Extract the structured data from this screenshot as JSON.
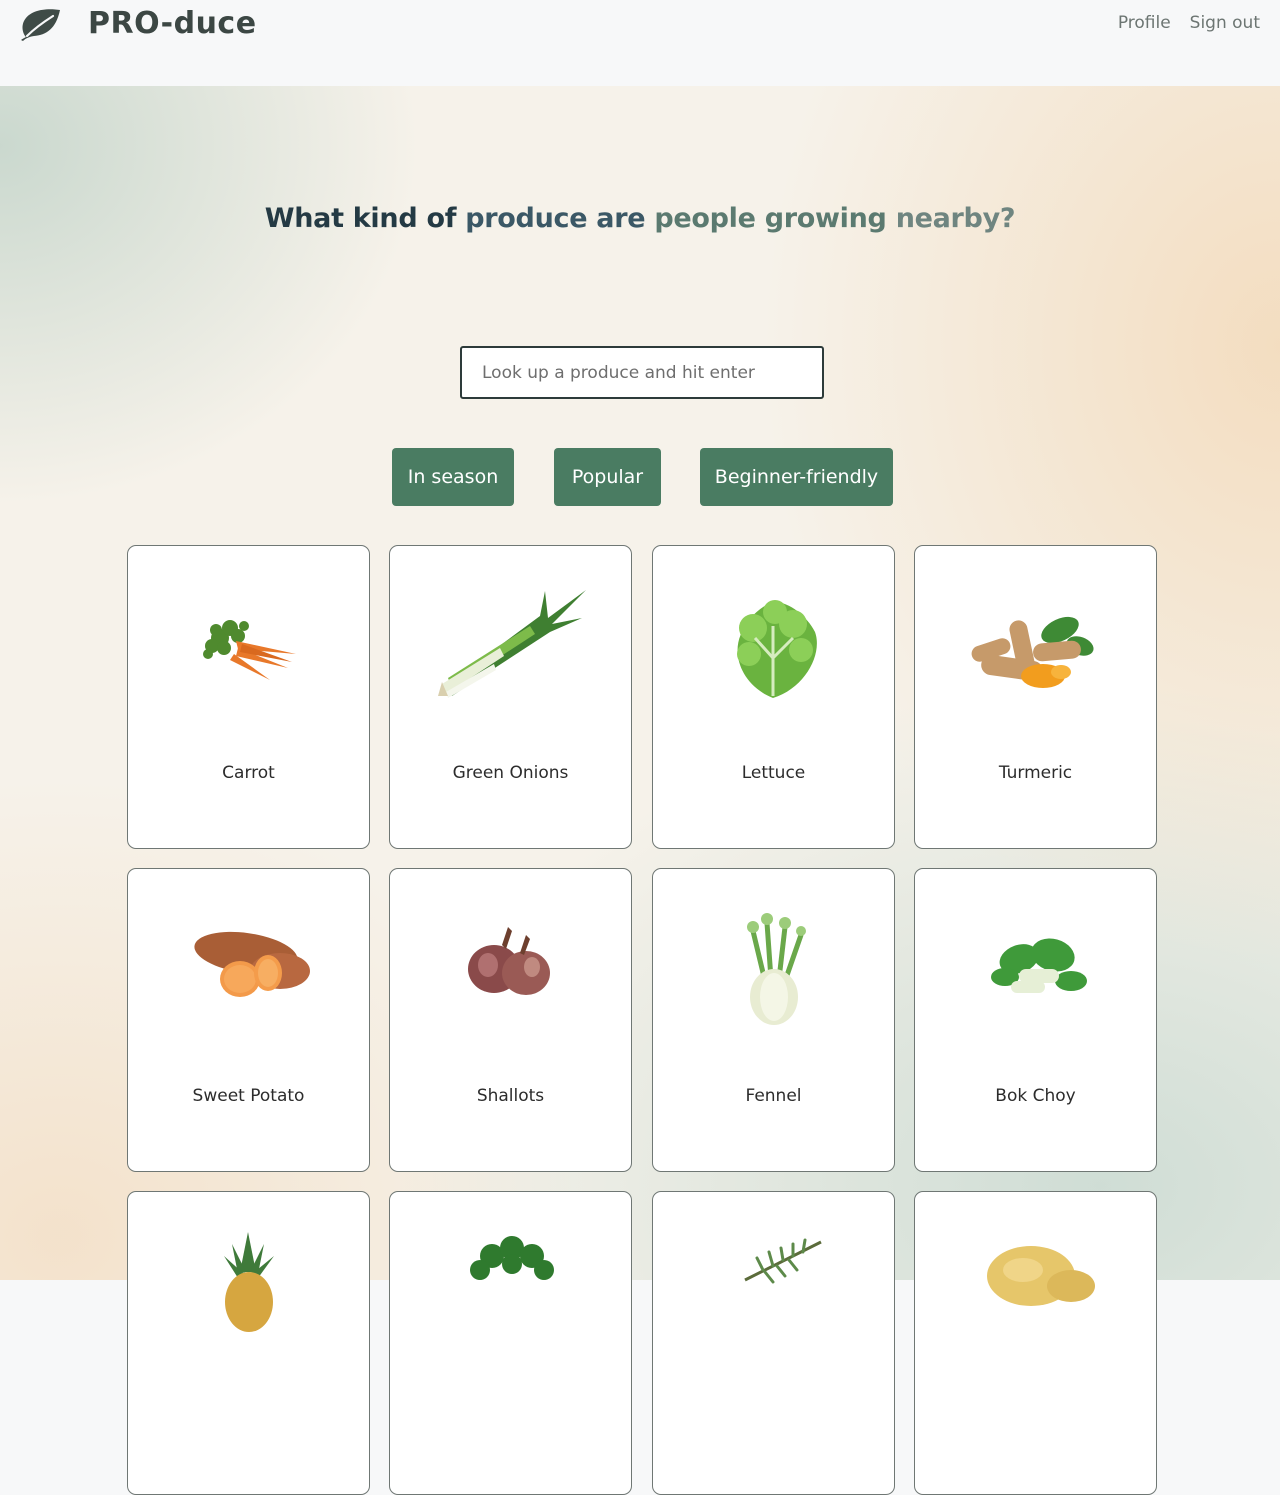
{
  "app": {
    "name": "PRO-duce",
    "logo_icon": "leaf-icon"
  },
  "nav": {
    "profile": "Profile",
    "sign_out": "Sign out"
  },
  "hero": {
    "headline_parts": [
      "What kind of ",
      "produce are ",
      "people growing ",
      "nearby?"
    ]
  },
  "search": {
    "placeholder": "Look up a produce and hit enter",
    "value": ""
  },
  "filters": [
    "In season",
    "Popular",
    "Beginner-friendly"
  ],
  "produce": [
    {
      "name": "Carrot",
      "icon": "carrot-icon"
    },
    {
      "name": "Green Onions",
      "icon": "green-onions-icon"
    },
    {
      "name": "Lettuce",
      "icon": "lettuce-icon"
    },
    {
      "name": "Turmeric",
      "icon": "turmeric-icon"
    },
    {
      "name": "Sweet Potato",
      "icon": "sweet-potato-icon"
    },
    {
      "name": "Shallots",
      "icon": "shallots-icon"
    },
    {
      "name": "Fennel",
      "icon": "fennel-icon"
    },
    {
      "name": "Bok Choy",
      "icon": "bok-choy-icon"
    },
    {
      "name": "",
      "icon": "pineapple-icon"
    },
    {
      "name": "",
      "icon": "parsley-icon"
    },
    {
      "name": "",
      "icon": "rosemary-icon"
    },
    {
      "name": "",
      "icon": "potato-icon"
    }
  ],
  "colors": {
    "accent": "#4a7c62",
    "brand_text": "#3c4744"
  }
}
